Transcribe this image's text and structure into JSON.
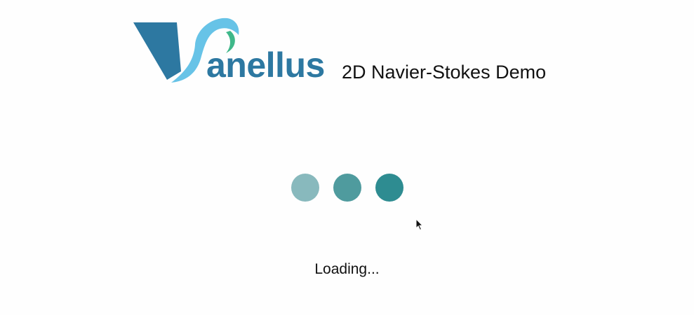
{
  "header": {
    "logo_text": "anellus",
    "app_title": "2D Navier-Stokes Demo"
  },
  "loading": {
    "text": "Loading...",
    "dots": [
      {
        "name": "loading-dot-1",
        "color": "#88b9bd"
      },
      {
        "name": "loading-dot-2",
        "color": "#4f9b9e"
      },
      {
        "name": "loading-dot-3",
        "color": "#2e8c91"
      }
    ]
  },
  "colors": {
    "brand_dark": "#2d78a1",
    "brand_light": "#67c3e7",
    "brand_green": "#3fb88a",
    "loader_teal": "#2e8c91",
    "background": "#fefefe"
  },
  "icons": {
    "logo": "vanellus-logo-icon",
    "cursor": "mouse-cursor-icon"
  }
}
